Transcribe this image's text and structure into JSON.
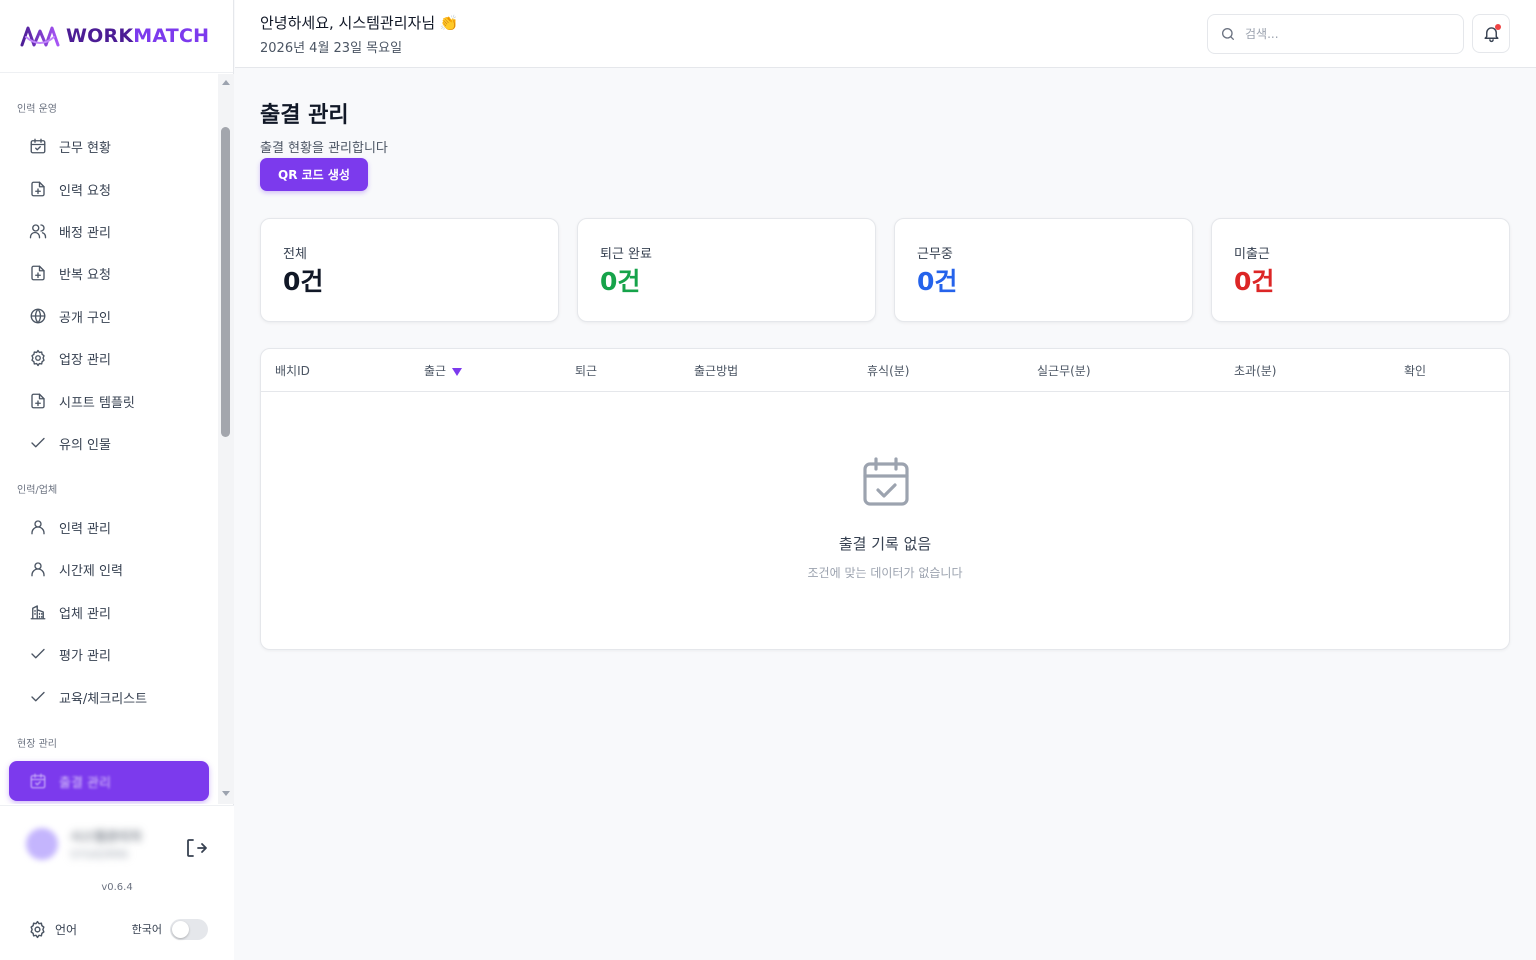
{
  "brand": {
    "name_part1": "WORK",
    "name_part2": "MATCH"
  },
  "sidebar": {
    "sections": [
      {
        "label": "인력 운영",
        "items": [
          {
            "label": "근무 현황",
            "icon": "calendar-check-icon"
          },
          {
            "label": "인력 요청",
            "icon": "file-plus-icon"
          },
          {
            "label": "배정 관리",
            "icon": "users-icon"
          },
          {
            "label": "반복 요청",
            "icon": "file-plus-icon"
          },
          {
            "label": "공개 구인",
            "icon": "globe-icon"
          },
          {
            "label": "업장 관리",
            "icon": "gear-icon"
          },
          {
            "label": "시프트 템플릿",
            "icon": "file-plus-icon"
          },
          {
            "label": "유의 인물",
            "icon": "check-icon"
          }
        ]
      },
      {
        "label": "인력/업체",
        "items": [
          {
            "label": "인력 관리",
            "icon": "user-icon"
          },
          {
            "label": "시간제 인력",
            "icon": "user-icon"
          },
          {
            "label": "업체 관리",
            "icon": "building-icon"
          },
          {
            "label": "평가 관리",
            "icon": "check-icon"
          },
          {
            "label": "교육/체크리스트",
            "icon": "check-icon"
          }
        ]
      },
      {
        "label": "현장 관리",
        "items": [
          {
            "label": "출결 관리",
            "icon": "calendar-icon",
            "active": true
          }
        ]
      }
    ]
  },
  "user": {
    "name": "시스템관리자",
    "role": "SYSADMIN"
  },
  "version": "v0.6.4",
  "language": {
    "label": "언어",
    "value": "한국어",
    "toggle_on": false
  },
  "header": {
    "greeting": "안녕하세요, 시스템관리자님 👏",
    "date": "2026년 4월 23일 목요일",
    "search_placeholder": "검색...",
    "notification_dot_color": "#ef4444"
  },
  "page": {
    "title": "출결 관리",
    "subtitle": "출결 현황을 관리합니다",
    "qr_button": "QR 코드 생성"
  },
  "stats": [
    {
      "label": "전체",
      "value": "0건",
      "color": "#111827"
    },
    {
      "label": "퇴근 완료",
      "value": "0건",
      "color": "#16a34a"
    },
    {
      "label": "근무중",
      "value": "0건",
      "color": "#2563eb"
    },
    {
      "label": "미출근",
      "value": "0건",
      "color": "#dc2626"
    }
  ],
  "table": {
    "columns": [
      "배치ID",
      "출근",
      "퇴근",
      "출근방법",
      "휴식(분)",
      "실근무(분)",
      "초과(분)",
      "확인"
    ],
    "sorted_column": "출근",
    "sort_direction": "desc",
    "rows": [],
    "empty_title": "출결 기록 없음",
    "empty_subtitle": "조건에 맞는 데이터가 없습니다"
  },
  "colors": {
    "accent": "#7c3aed"
  }
}
